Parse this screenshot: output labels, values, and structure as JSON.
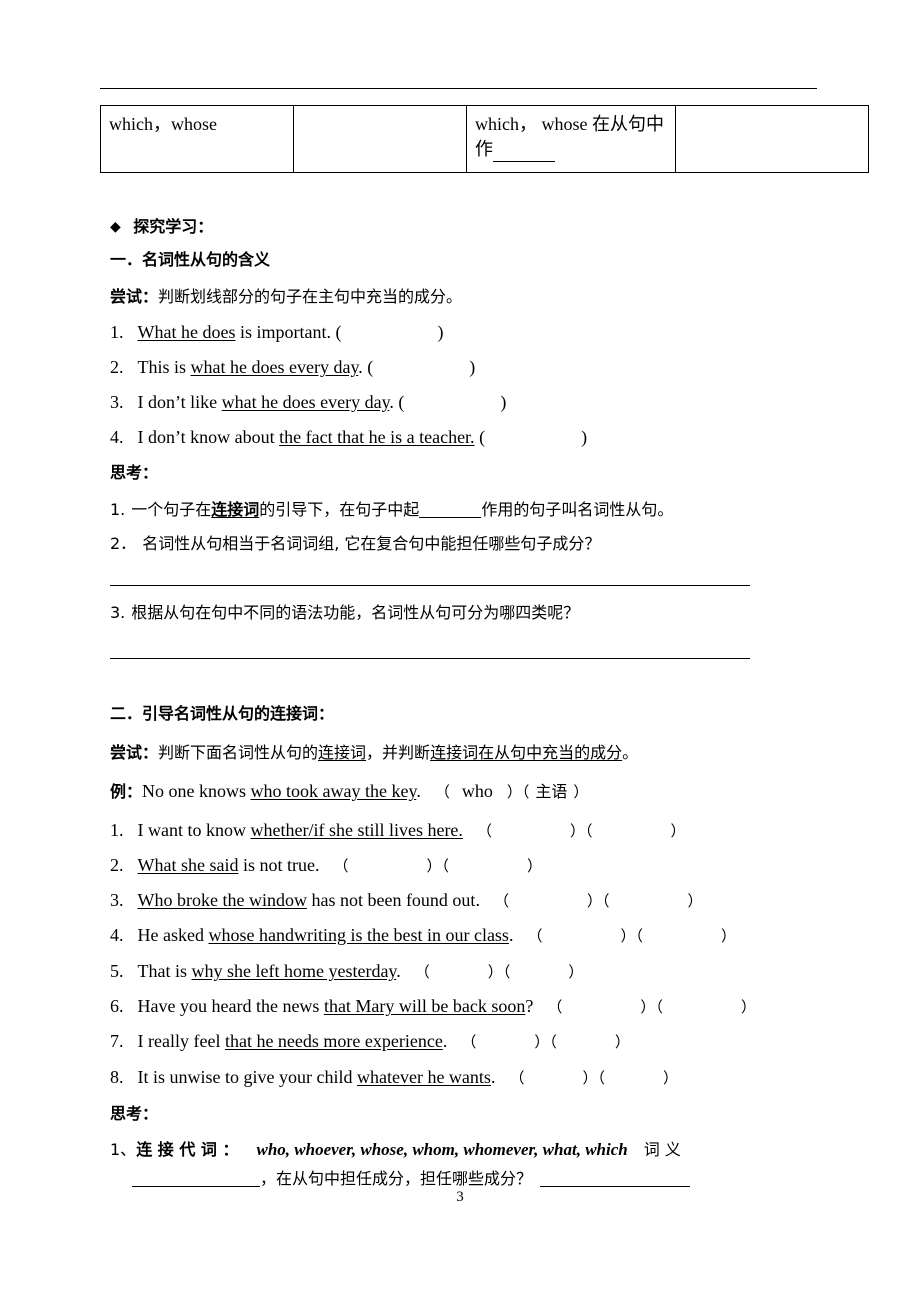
{
  "document": {
    "page_number": "3"
  },
  "table": {
    "rows": [
      {
        "cells": [
          {
            "text": "which，whose",
            "blank_after": false
          },
          {
            "text": "",
            "blank_after": false
          },
          {
            "text": "which， whose 在从句中作",
            "blank_after": true
          },
          {
            "text": "",
            "blank_after": false
          }
        ]
      }
    ]
  },
  "sections": {
    "explore_heading": "探究学习：",
    "section_one": {
      "heading": "一．名词性从句的含义",
      "try_label": "尝试：",
      "try_text": "判断划线部分的句子在主句中充当的成分。",
      "items": [
        {
          "num": "1.",
          "pre": "",
          "underlined": "What he does",
          "post": " is important. (",
          "close": ")"
        },
        {
          "num": "2.",
          "pre": "This is ",
          "underlined": "what he does every day",
          "post": ". (",
          "close": ")"
        },
        {
          "num": "3.",
          "pre": "I don’t like ",
          "underlined": "what he does every day",
          "post": ". (",
          "close": ")"
        },
        {
          "num": "4.",
          "pre": "I don’t know about ",
          "underlined": "the fact that he is a teacher.",
          "post": " (",
          "close": ")"
        }
      ],
      "think_label": "思考：",
      "think_items": [
        {
          "num": "1.",
          "part_a": "一个句子在",
          "bold": "连接词",
          "part_b": "的引导下，在句子中起",
          "part_c": "作用的句子叫名词性从句。"
        },
        {
          "num": "2．",
          "text": "名词性从句相当于名词词组, 它在复合句中能担任哪些句子成分？"
        },
        {
          "num": "3.",
          "text": "根据从句在句中不同的语法功能，名词性从句可分为哪四类呢？"
        }
      ]
    },
    "section_two": {
      "heading": "二．引导名词性从句的连接词：",
      "try_label": "尝试：",
      "try_pre": "判断下面名词性从句的",
      "try_u1": "连接词",
      "try_mid": "，并判断",
      "try_u2": "连接词在从句中充当的成分",
      "try_end": "。",
      "example_label": "例：",
      "example_pre": "No one knows ",
      "example_u": "who took away the key",
      "example_post": ".",
      "example_ans1": "who",
      "example_ans2": "主语",
      "items": [
        {
          "num": "1.",
          "pre": "I want to know ",
          "underlined": "whether/if she still lives here.",
          "post": ""
        },
        {
          "num": "2.",
          "pre": "",
          "underlined": "What she said",
          "post": " is not true."
        },
        {
          "num": "3.",
          "pre": "",
          "underlined": "Who broke the window",
          "post": " has not been found out."
        },
        {
          "num": "4.",
          "pre": "He asked ",
          "underlined": "whose handwriting is the best in our class",
          "post": "."
        },
        {
          "num": "5.",
          "pre": "That is ",
          "underlined": "why she left home yesterday",
          "post": "."
        },
        {
          "num": "6.",
          "pre": "Have you heard the news ",
          "underlined": "that Mary will be back soon",
          "post": "?"
        },
        {
          "num": "7.",
          "pre": "I really feel ",
          "underlined": "that he needs more experience",
          "post": "."
        },
        {
          "num": "8.",
          "pre": "It is unwise to give your child ",
          "underlined": "whatever he wants",
          "post": "."
        }
      ],
      "think_label": "思考：",
      "think_item": {
        "num": "1、",
        "label": "连 接 代 词 ：",
        "words": "who, whoever, whose, whom, whomever, what, which",
        "tail": "词 义",
        "line2_mid": "，在从句中担任成分，担任哪些成分？"
      }
    }
  }
}
